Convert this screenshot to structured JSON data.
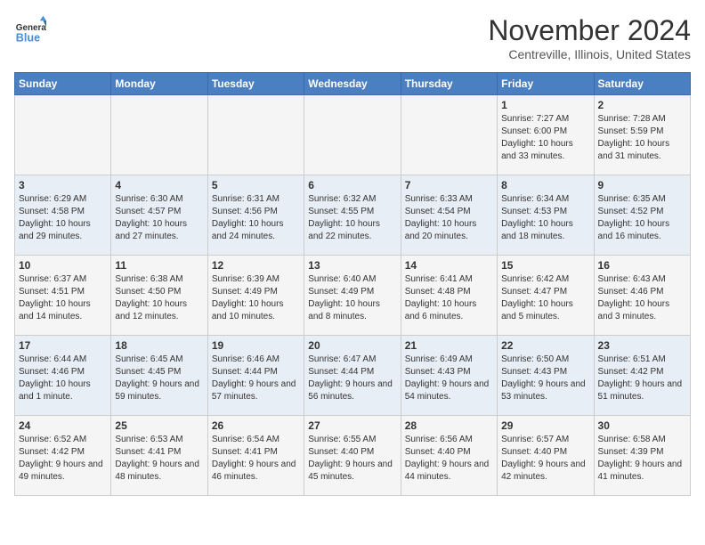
{
  "logo": {
    "text_general": "General",
    "text_blue": "Blue"
  },
  "header": {
    "month": "November 2024",
    "location": "Centreville, Illinois, United States"
  },
  "weekdays": [
    "Sunday",
    "Monday",
    "Tuesday",
    "Wednesday",
    "Thursday",
    "Friday",
    "Saturday"
  ],
  "weeks": [
    [
      {
        "day": "",
        "sunrise": "",
        "sunset": "",
        "daylight": ""
      },
      {
        "day": "",
        "sunrise": "",
        "sunset": "",
        "daylight": ""
      },
      {
        "day": "",
        "sunrise": "",
        "sunset": "",
        "daylight": ""
      },
      {
        "day": "",
        "sunrise": "",
        "sunset": "",
        "daylight": ""
      },
      {
        "day": "",
        "sunrise": "",
        "sunset": "",
        "daylight": ""
      },
      {
        "day": "1",
        "sunrise": "Sunrise: 7:27 AM",
        "sunset": "Sunset: 6:00 PM",
        "daylight": "Daylight: 10 hours and 33 minutes."
      },
      {
        "day": "2",
        "sunrise": "Sunrise: 7:28 AM",
        "sunset": "Sunset: 5:59 PM",
        "daylight": "Daylight: 10 hours and 31 minutes."
      }
    ],
    [
      {
        "day": "3",
        "sunrise": "Sunrise: 6:29 AM",
        "sunset": "Sunset: 4:58 PM",
        "daylight": "Daylight: 10 hours and 29 minutes."
      },
      {
        "day": "4",
        "sunrise": "Sunrise: 6:30 AM",
        "sunset": "Sunset: 4:57 PM",
        "daylight": "Daylight: 10 hours and 27 minutes."
      },
      {
        "day": "5",
        "sunrise": "Sunrise: 6:31 AM",
        "sunset": "Sunset: 4:56 PM",
        "daylight": "Daylight: 10 hours and 24 minutes."
      },
      {
        "day": "6",
        "sunrise": "Sunrise: 6:32 AM",
        "sunset": "Sunset: 4:55 PM",
        "daylight": "Daylight: 10 hours and 22 minutes."
      },
      {
        "day": "7",
        "sunrise": "Sunrise: 6:33 AM",
        "sunset": "Sunset: 4:54 PM",
        "daylight": "Daylight: 10 hours and 20 minutes."
      },
      {
        "day": "8",
        "sunrise": "Sunrise: 6:34 AM",
        "sunset": "Sunset: 4:53 PM",
        "daylight": "Daylight: 10 hours and 18 minutes."
      },
      {
        "day": "9",
        "sunrise": "Sunrise: 6:35 AM",
        "sunset": "Sunset: 4:52 PM",
        "daylight": "Daylight: 10 hours and 16 minutes."
      }
    ],
    [
      {
        "day": "10",
        "sunrise": "Sunrise: 6:37 AM",
        "sunset": "Sunset: 4:51 PM",
        "daylight": "Daylight: 10 hours and 14 minutes."
      },
      {
        "day": "11",
        "sunrise": "Sunrise: 6:38 AM",
        "sunset": "Sunset: 4:50 PM",
        "daylight": "Daylight: 10 hours and 12 minutes."
      },
      {
        "day": "12",
        "sunrise": "Sunrise: 6:39 AM",
        "sunset": "Sunset: 4:49 PM",
        "daylight": "Daylight: 10 hours and 10 minutes."
      },
      {
        "day": "13",
        "sunrise": "Sunrise: 6:40 AM",
        "sunset": "Sunset: 4:49 PM",
        "daylight": "Daylight: 10 hours and 8 minutes."
      },
      {
        "day": "14",
        "sunrise": "Sunrise: 6:41 AM",
        "sunset": "Sunset: 4:48 PM",
        "daylight": "Daylight: 10 hours and 6 minutes."
      },
      {
        "day": "15",
        "sunrise": "Sunrise: 6:42 AM",
        "sunset": "Sunset: 4:47 PM",
        "daylight": "Daylight: 10 hours and 5 minutes."
      },
      {
        "day": "16",
        "sunrise": "Sunrise: 6:43 AM",
        "sunset": "Sunset: 4:46 PM",
        "daylight": "Daylight: 10 hours and 3 minutes."
      }
    ],
    [
      {
        "day": "17",
        "sunrise": "Sunrise: 6:44 AM",
        "sunset": "Sunset: 4:46 PM",
        "daylight": "Daylight: 10 hours and 1 minute."
      },
      {
        "day": "18",
        "sunrise": "Sunrise: 6:45 AM",
        "sunset": "Sunset: 4:45 PM",
        "daylight": "Daylight: 9 hours and 59 minutes."
      },
      {
        "day": "19",
        "sunrise": "Sunrise: 6:46 AM",
        "sunset": "Sunset: 4:44 PM",
        "daylight": "Daylight: 9 hours and 57 minutes."
      },
      {
        "day": "20",
        "sunrise": "Sunrise: 6:47 AM",
        "sunset": "Sunset: 4:44 PM",
        "daylight": "Daylight: 9 hours and 56 minutes."
      },
      {
        "day": "21",
        "sunrise": "Sunrise: 6:49 AM",
        "sunset": "Sunset: 4:43 PM",
        "daylight": "Daylight: 9 hours and 54 minutes."
      },
      {
        "day": "22",
        "sunrise": "Sunrise: 6:50 AM",
        "sunset": "Sunset: 4:43 PM",
        "daylight": "Daylight: 9 hours and 53 minutes."
      },
      {
        "day": "23",
        "sunrise": "Sunrise: 6:51 AM",
        "sunset": "Sunset: 4:42 PM",
        "daylight": "Daylight: 9 hours and 51 minutes."
      }
    ],
    [
      {
        "day": "24",
        "sunrise": "Sunrise: 6:52 AM",
        "sunset": "Sunset: 4:42 PM",
        "daylight": "Daylight: 9 hours and 49 minutes."
      },
      {
        "day": "25",
        "sunrise": "Sunrise: 6:53 AM",
        "sunset": "Sunset: 4:41 PM",
        "daylight": "Daylight: 9 hours and 48 minutes."
      },
      {
        "day": "26",
        "sunrise": "Sunrise: 6:54 AM",
        "sunset": "Sunset: 4:41 PM",
        "daylight": "Daylight: 9 hours and 46 minutes."
      },
      {
        "day": "27",
        "sunrise": "Sunrise: 6:55 AM",
        "sunset": "Sunset: 4:40 PM",
        "daylight": "Daylight: 9 hours and 45 minutes."
      },
      {
        "day": "28",
        "sunrise": "Sunrise: 6:56 AM",
        "sunset": "Sunset: 4:40 PM",
        "daylight": "Daylight: 9 hours and 44 minutes."
      },
      {
        "day": "29",
        "sunrise": "Sunrise: 6:57 AM",
        "sunset": "Sunset: 4:40 PM",
        "daylight": "Daylight: 9 hours and 42 minutes."
      },
      {
        "day": "30",
        "sunrise": "Sunrise: 6:58 AM",
        "sunset": "Sunset: 4:39 PM",
        "daylight": "Daylight: 9 hours and 41 minutes."
      }
    ]
  ]
}
